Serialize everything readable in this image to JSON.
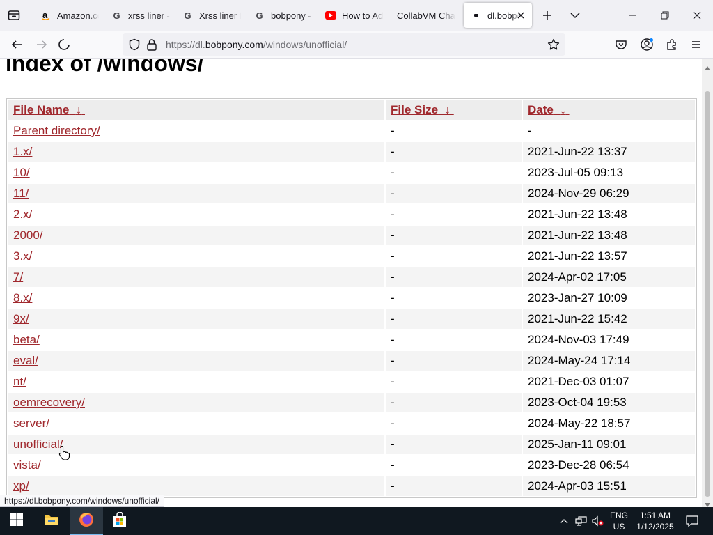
{
  "tabs": [
    {
      "title": "Amazon.com",
      "icon": "amazon-icon"
    },
    {
      "title": "xrss liner - Google Search",
      "icon": "google-icon"
    },
    {
      "title": "Xrss liner for sale",
      "icon": "google-icon"
    },
    {
      "title": "bobpony - Google Search",
      "icon": "google-icon"
    },
    {
      "title": "How to Add",
      "icon": "youtube-icon"
    },
    {
      "title": "CollabVM Chat",
      "icon": "collabvm-icon"
    },
    {
      "title": "dl.bobpony.com",
      "icon": "page-icon",
      "active": true
    }
  ],
  "navbar": {
    "url_prefix": "https://dl.",
    "url_domain": "bobpony.com",
    "url_path": "/windows/unofficial/"
  },
  "page": {
    "title": "Index of /windows/",
    "headers": {
      "name": "File Name",
      "size": "File Size",
      "date": "Date",
      "sort_glyph": "↓"
    },
    "rows": [
      {
        "name": "Parent directory/",
        "size": "-",
        "date": "-"
      },
      {
        "name": "1.x/",
        "size": "-",
        "date": "2021-Jun-22 13:37"
      },
      {
        "name": "10/",
        "size": "-",
        "date": "2023-Jul-05 09:13"
      },
      {
        "name": "11/",
        "size": "-",
        "date": "2024-Nov-29 06:29"
      },
      {
        "name": "2.x/",
        "size": "-",
        "date": "2021-Jun-22 13:48"
      },
      {
        "name": "2000/",
        "size": "-",
        "date": "2021-Jun-22 13:48"
      },
      {
        "name": "3.x/",
        "size": "-",
        "date": "2021-Jun-22 13:57"
      },
      {
        "name": "7/",
        "size": "-",
        "date": "2024-Apr-02 17:05"
      },
      {
        "name": "8.x/",
        "size": "-",
        "date": "2023-Jan-27 10:09"
      },
      {
        "name": "9x/",
        "size": "-",
        "date": "2021-Jun-22 15:42"
      },
      {
        "name": "beta/",
        "size": "-",
        "date": "2024-Nov-03 17:49"
      },
      {
        "name": "eval/",
        "size": "-",
        "date": "2024-May-24 17:14"
      },
      {
        "name": "nt/",
        "size": "-",
        "date": "2021-Dec-03 01:07"
      },
      {
        "name": "oemrecovery/",
        "size": "-",
        "date": "2023-Oct-04 19:53"
      },
      {
        "name": "server/",
        "size": "-",
        "date": "2024-May-22 18:57"
      },
      {
        "name": "unofficial/",
        "size": "-",
        "date": "2025-Jan-11 09:01"
      },
      {
        "name": "vista/",
        "size": "-",
        "date": "2023-Dec-28 06:54"
      },
      {
        "name": "xp/",
        "size": "-",
        "date": "2024-Apr-03 15:51"
      }
    ]
  },
  "statusbar": {
    "link_url": "https://dl.bobpony.com/windows/unofficial/"
  },
  "taskbar": {
    "lang_line1": "ENG",
    "lang_line2": "US",
    "time": "1:51 AM",
    "date": "1/12/2025"
  },
  "colors": {
    "link": "#a0282d",
    "taskbar": "#101820",
    "tabstrip": "#f0f0f4"
  }
}
